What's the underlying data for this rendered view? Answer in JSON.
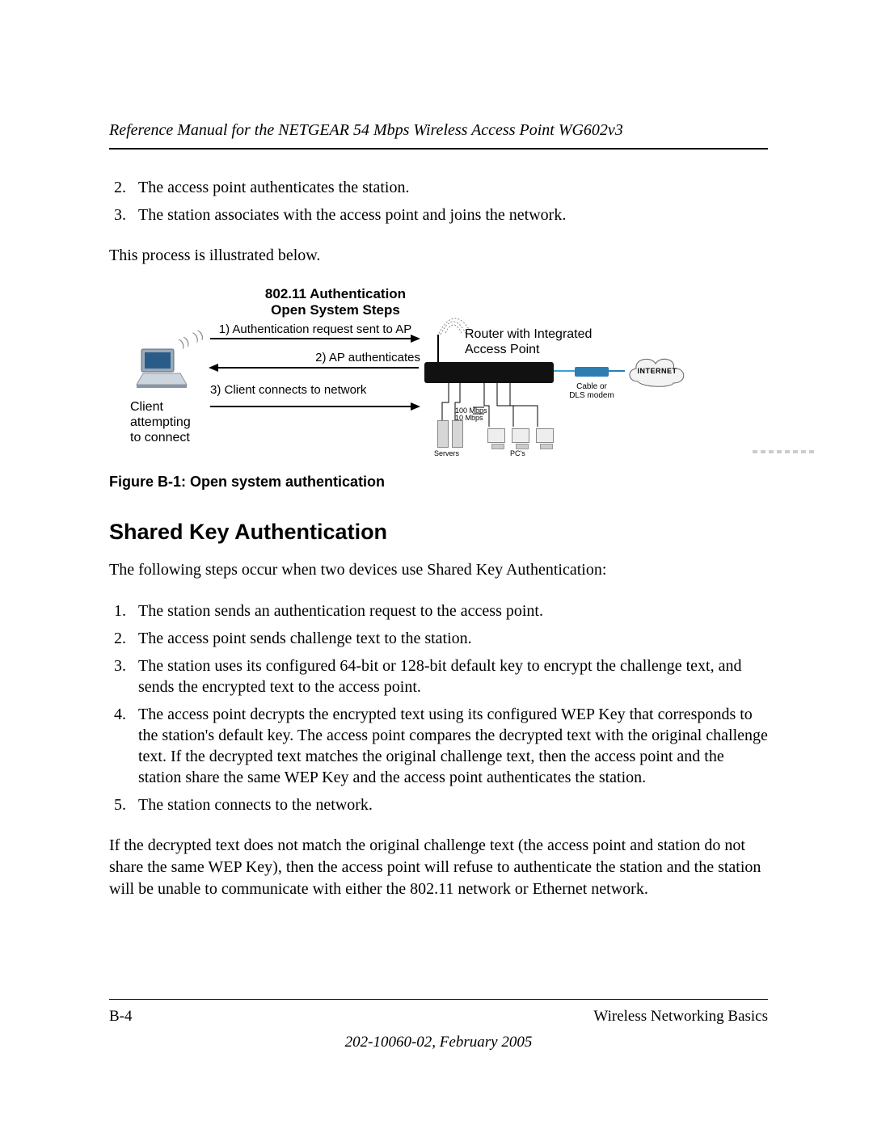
{
  "header": {
    "running_title": "Reference Manual for the NETGEAR 54 Mbps Wireless Access Point WG602v3"
  },
  "top_list": {
    "item2": "The access point authenticates the station.",
    "item3": "The station associates with the access point and joins the network."
  },
  "intro_para": "This process is illustrated below.",
  "diagram": {
    "title_line1": "802.11 Authentication",
    "title_line2": "Open System Steps",
    "step1": "1) Authentication request sent to AP",
    "step2": "2) AP authenticates",
    "step3": "3) Client connects to network",
    "client_label_l1": "Client",
    "client_label_l2": "attempting",
    "client_label_l3": "to connect",
    "router_label_l1": "Router with Integrated",
    "router_label_l2": "Access Point",
    "modem_label_l1": "Cable or",
    "modem_label_l2": "DLS modem",
    "speed_l1": "100 Mbps",
    "speed_l2": "10 Mbps",
    "internet": "INTERNET",
    "servers": "Servers",
    "pcs": "PC's"
  },
  "figure_caption": "Figure B-1:  Open system authentication",
  "section_heading": "Shared Key Authentication",
  "section_intro": "The following steps occur when two devices use Shared Key Authentication:",
  "steps": {
    "s1": "The station sends an authentication request to the access point.",
    "s2": "The access point sends challenge text to the station.",
    "s3": "The station uses its configured 64-bit or 128-bit default key to encrypt the challenge text, and sends the encrypted text to the access point.",
    "s4": "The access point decrypts the encrypted text using its configured WEP Key that corresponds to the station's default key. The access point compares the decrypted text with the original challenge text. If the decrypted text matches the original challenge text, then the access point and the station share the same WEP Key and the access point authenticates the station.",
    "s5": "The station connects to the network."
  },
  "closing_para": "If the decrypted text does not match the original challenge text (the access point and station do not share the same WEP Key), then the access point will refuse to authenticate the station and the station will be unable to communicate with either the 802.11 network or Ethernet network.",
  "footer": {
    "page": "B-4",
    "section": "Wireless Networking Basics",
    "docline": "202-10060-02, February 2005"
  }
}
